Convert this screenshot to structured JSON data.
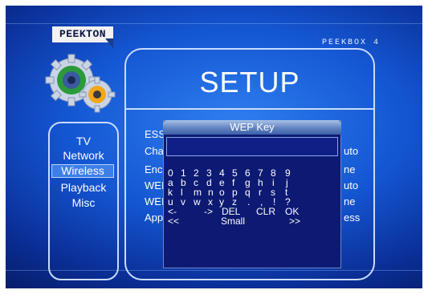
{
  "brand": {
    "logo_text": "PEEKTON",
    "model_text": "PEEKBOX 4"
  },
  "screen": {
    "title": "SETUP"
  },
  "sidebar": {
    "items": [
      "TV",
      "Network",
      "Wireless",
      "Playback",
      "Misc"
    ],
    "selected": "Wireless"
  },
  "settings": {
    "labels": [
      "ESS",
      "Cha",
      "Enc",
      "WEI",
      "WEI",
      "App"
    ],
    "values": [
      "",
      "uto",
      "ne",
      "uto",
      "ne",
      "ess"
    ]
  },
  "dialog": {
    "title": "WEP Key",
    "input_value": "",
    "keyboard": {
      "row1": [
        "0",
        "1",
        "2",
        "3",
        "4",
        "5",
        "6",
        "7",
        "8",
        "9"
      ],
      "row2": [
        "a",
        "b",
        "c",
        "d",
        "e",
        "f",
        "g",
        "h",
        "i",
        "j"
      ],
      "row3": [
        "k",
        "l",
        "m",
        "n",
        "o",
        "p",
        "q",
        "r",
        "s",
        "t"
      ],
      "row4": [
        "u",
        "v",
        "w",
        "x",
        "y",
        "z",
        ".",
        ",",
        "!",
        "?"
      ],
      "row5": [
        "<-",
        "->",
        "DEL",
        "CLR",
        "OK"
      ],
      "row6": [
        "<<",
        "Small",
        ">>"
      ]
    }
  },
  "colors": {
    "background": "#1456d2",
    "panel_border": "#c8dcff",
    "selected": "#3d7fe6",
    "dialog": "#0d1a73"
  }
}
